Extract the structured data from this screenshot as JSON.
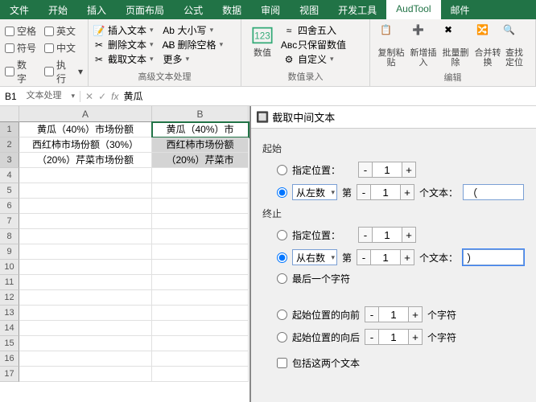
{
  "tabs": {
    "file": "文件",
    "home": "开始",
    "insert": "插入",
    "layout": "页面布局",
    "formula": "公式",
    "data": "数据",
    "review": "审阅",
    "view": "视图",
    "dev": "开发工具",
    "aud": "AudTool",
    "mail": "邮件"
  },
  "group_text": {
    "space": "空格",
    "english": "英文",
    "symbol": "符号",
    "chinese": "中文",
    "number": "数字",
    "execute": "执行",
    "label": "文本处理",
    "insert_text": "插入文本",
    "case": "大小写",
    "delete_text": "删除文本",
    "delete_space": "删除空格",
    "extract_text": "截取文本",
    "more": "更多",
    "label2": "高级文本处理"
  },
  "group_value": {
    "numval": "数值",
    "round": "四舍五入",
    "keepnum": "只保留数值",
    "custom": "自定义",
    "label": "数值录入"
  },
  "group_edit": {
    "paste": "复制粘贴",
    "add": "新增插入",
    "batchdel": "批量删除",
    "merge": "合并转换",
    "find": "查找定位",
    "label": "编辑"
  },
  "cellref": "B1",
  "fx": "fx",
  "cellval": "黄瓜",
  "cells": {
    "a1": "黄瓜（40%）市场份额",
    "b1": "黄瓜（40%）市",
    "a2": "西红柿市场份额（30%）",
    "b2": "西红柿市场份额",
    "a3": "（20%）芹菜市场份额",
    "b3": "（20%）芹菜市"
  },
  "dialog": {
    "title": "截取中间文本",
    "start": "起始",
    "end": "终止",
    "pos_label": "指定位置：",
    "fromleft": "从左数",
    "fromright": "从右数",
    "th": "第",
    "unit_text": "个文本：",
    "lastchar": "最后一个字符",
    "before_start": "起始位置的向前",
    "after_start": "起始位置的向后",
    "unit_char": "个字符",
    "include": "包括这两个文本",
    "val_start_text": "（",
    "val_end_text": "）",
    "one": "1"
  }
}
